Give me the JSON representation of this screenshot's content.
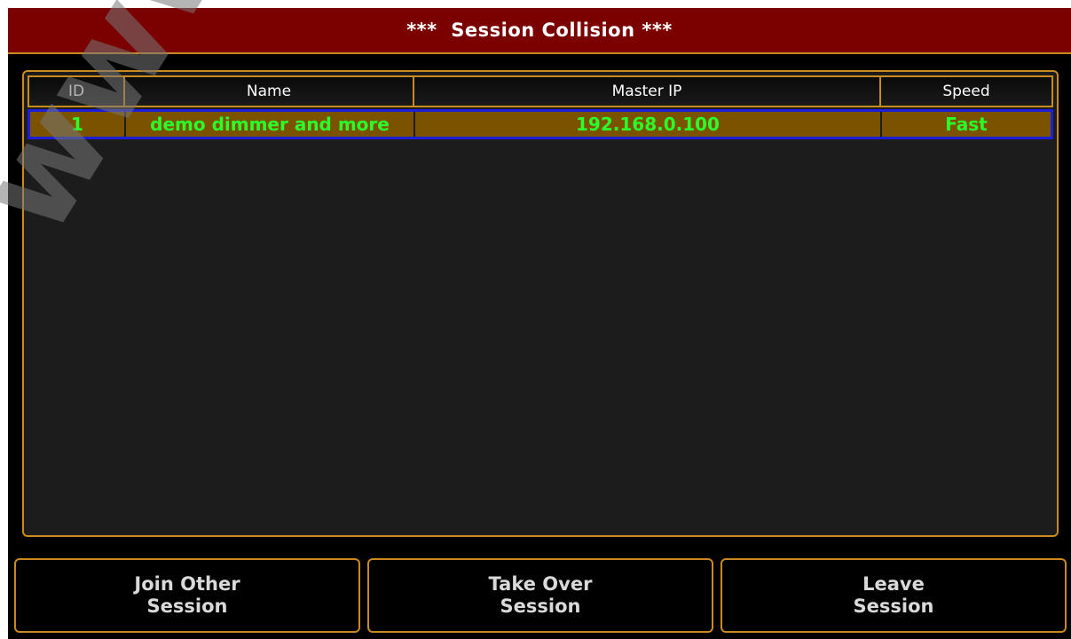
{
  "window": {
    "title": "***  Session Collision ***"
  },
  "table": {
    "columns": [
      "ID",
      "Name",
      "Master IP",
      "Speed"
    ],
    "rows": [
      {
        "id": "1",
        "name": "demo dimmer and more",
        "master_ip": "192.168.0.100",
        "speed": "Fast",
        "selected": true
      }
    ]
  },
  "buttons": {
    "join": {
      "line1": "Join Other",
      "line2": "Session"
    },
    "takeover": {
      "line1": "Take Over",
      "line2": "Session"
    },
    "leave": {
      "line1": "Leave",
      "line2": "Session"
    }
  },
  "watermark": "www.carlosme",
  "colors": {
    "title_bar": "#7b0000",
    "border_accent": "#c98a1e",
    "selected_row_bg": "#7a5200",
    "selected_row_border": "#1e1ed8",
    "selected_row_text": "#2aff2a"
  }
}
